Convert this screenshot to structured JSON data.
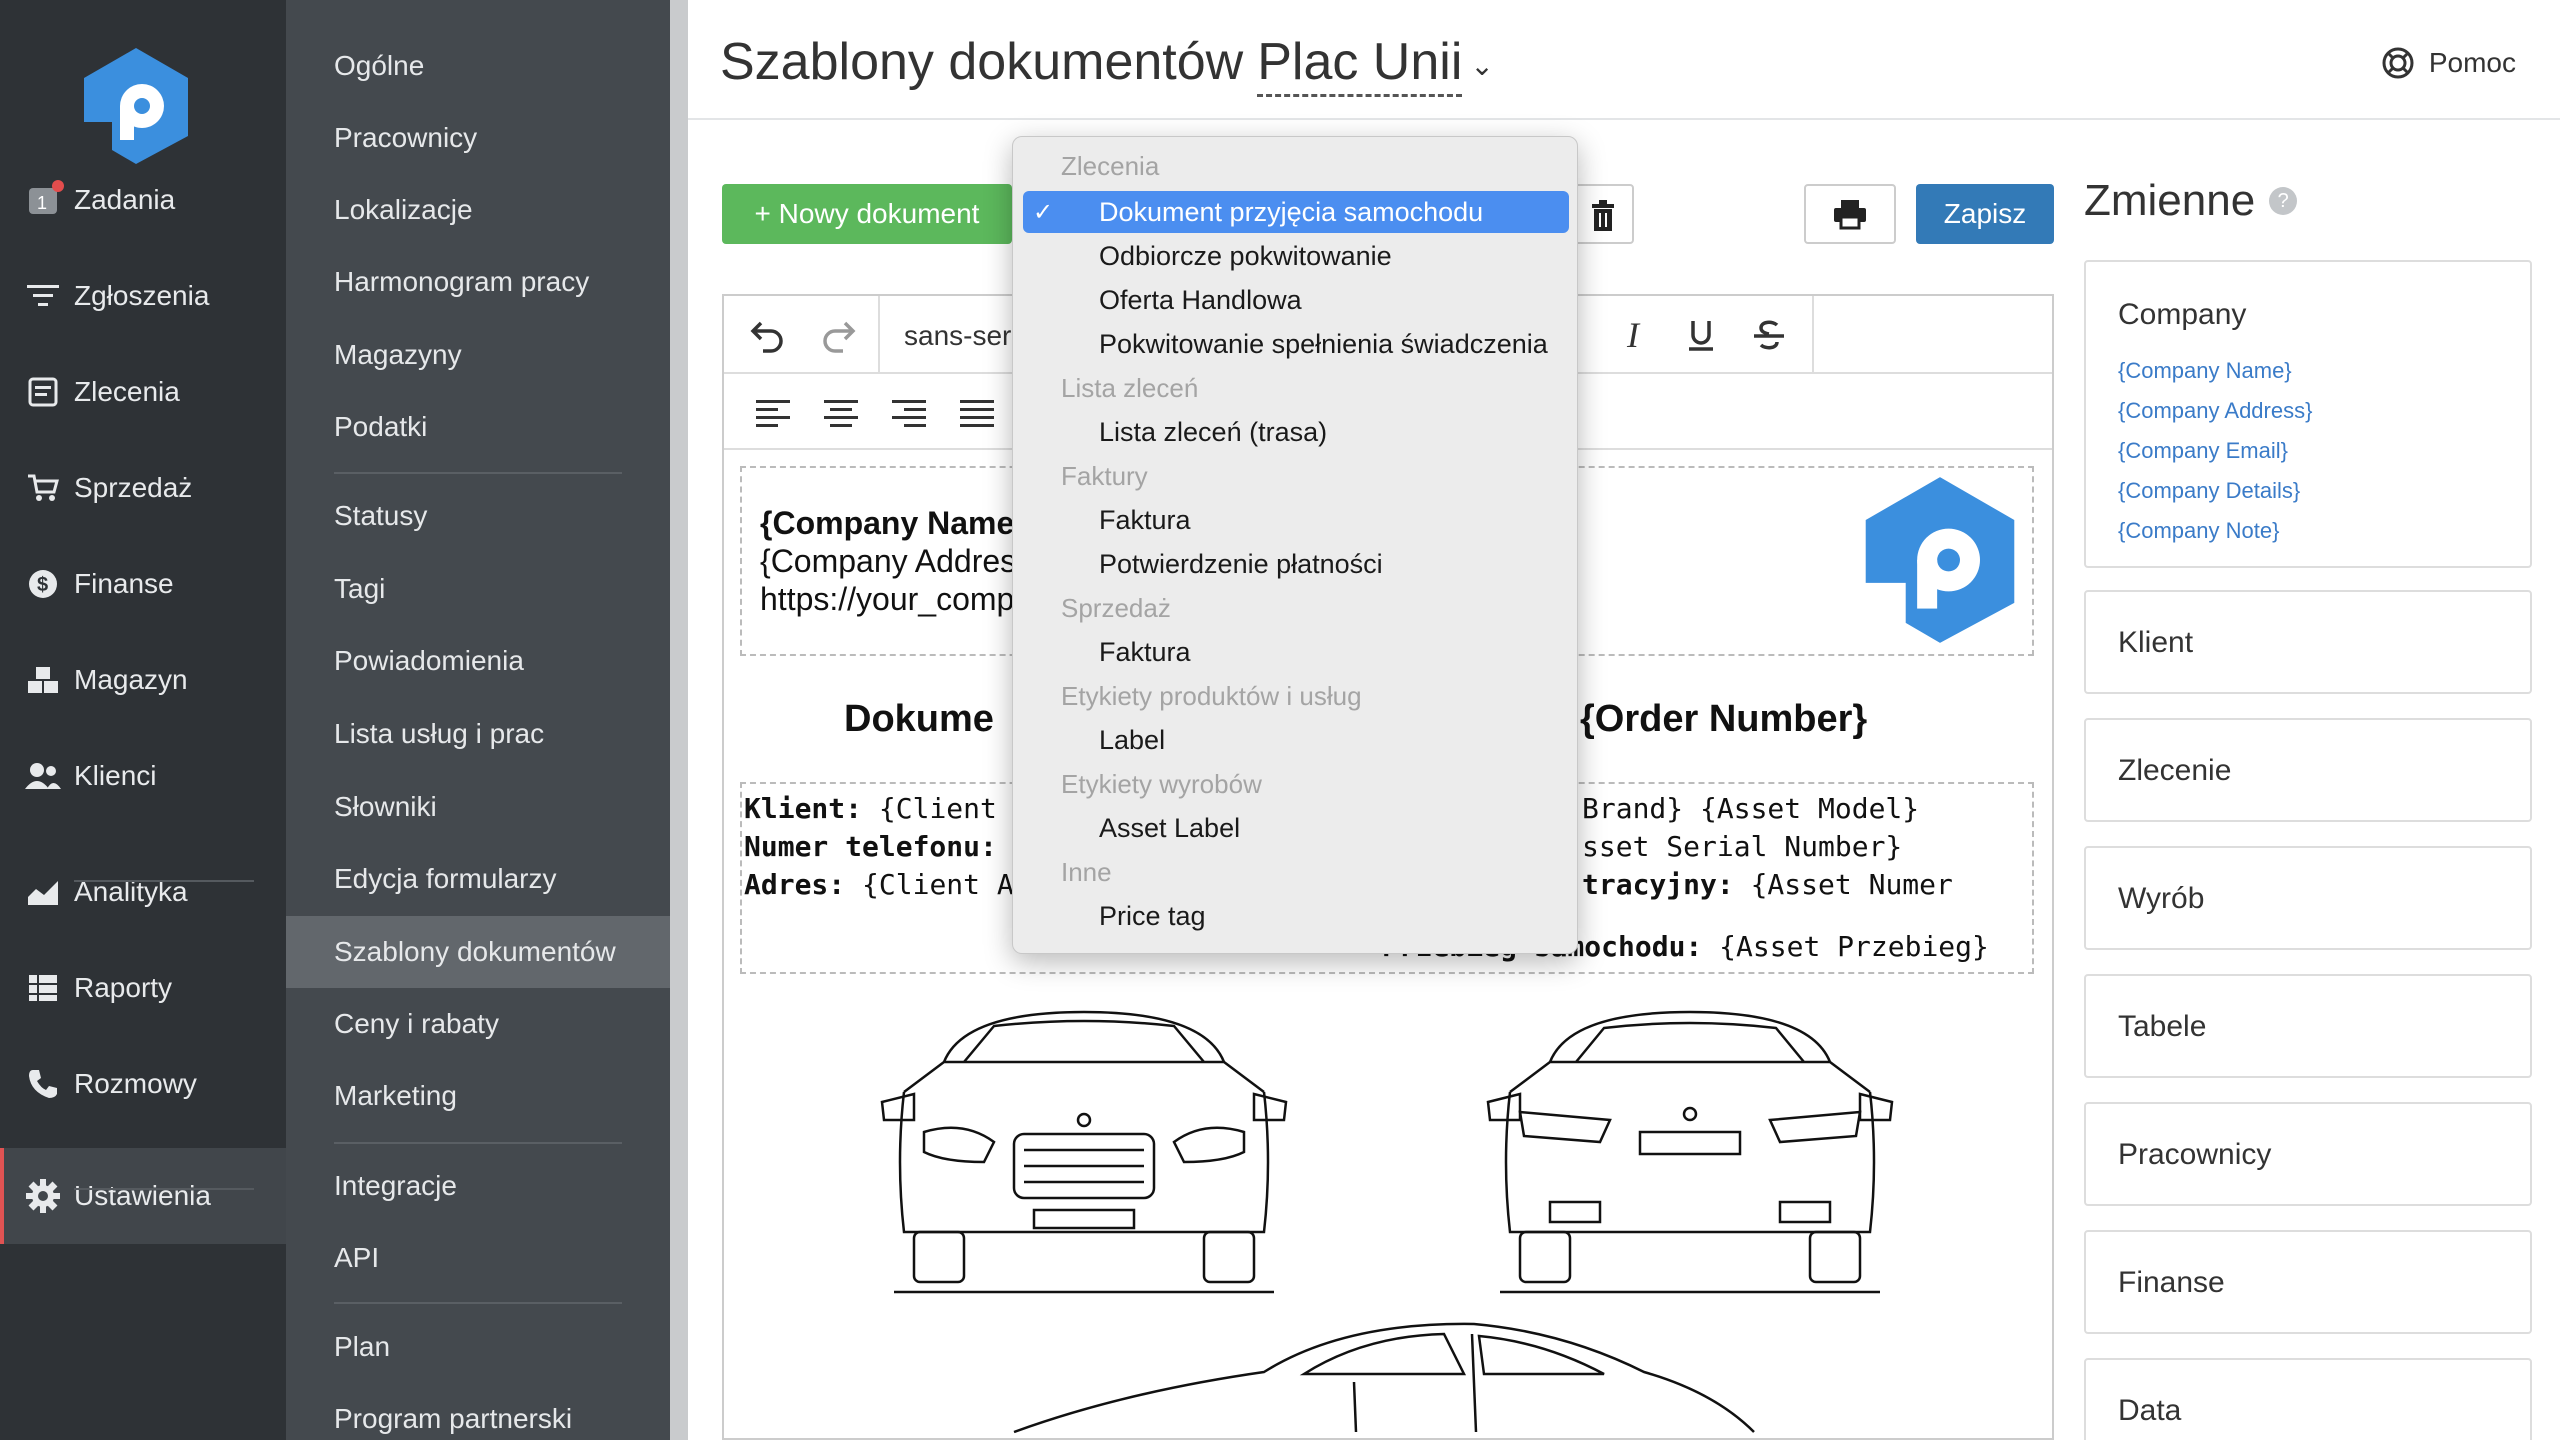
{
  "rail": {
    "items": [
      {
        "label": "Zadania",
        "icon": "tasks-icon"
      },
      {
        "label": "Zgłoszenia",
        "icon": "filter-icon"
      },
      {
        "label": "Zlecenia",
        "icon": "orders-icon"
      },
      {
        "label": "Sprzedaż",
        "icon": "cart-icon"
      },
      {
        "label": "Finanse",
        "icon": "dollar-icon"
      },
      {
        "label": "Magazyn",
        "icon": "warehouse-icon"
      },
      {
        "label": "Klienci",
        "icon": "users-icon"
      },
      {
        "label": "Analityka",
        "icon": "chart-icon"
      },
      {
        "label": "Raporty",
        "icon": "reports-icon"
      },
      {
        "label": "Rozmowy",
        "icon": "phone-icon"
      },
      {
        "label": "Ustawienia",
        "icon": "gear-icon"
      }
    ],
    "tasks_badge": "1",
    "active": "Ustawienia"
  },
  "submenu": {
    "items": [
      "Ogólne",
      "Pracownicy",
      "Lokalizacje",
      "Harmonogram pracy",
      "Magazyny",
      "Podatki",
      "Statusy",
      "Tagi",
      "Powiadomienia",
      "Lista usług i prac",
      "Słowniki",
      "Edycja formularzy",
      "Szablony dokumentów",
      "Ceny i rabaty",
      "Marketing",
      "Integracje",
      "API",
      "Plan",
      "Program partnerski"
    ],
    "active": "Szablony dokumentów"
  },
  "header": {
    "title": "Szablony dokumentów",
    "location": "Plac Unii",
    "help": "Pomoc"
  },
  "toolbar": {
    "new_doc": "+ Nowy dokument",
    "save": "Zapisz",
    "font": "sans-ser"
  },
  "document": {
    "header_lines": [
      "{Company Name}",
      "{Company Address",
      "https://your_compa"
    ],
    "title_left": "Dokume",
    "title_right": "{Order Number}",
    "client_lines": [
      {
        "label": "Klient:",
        "value": "{Client Nam"
      },
      {
        "label": "Numer telefonu:",
        "value": "{"
      },
      {
        "label": "Adres:",
        "value": "{Client Addr"
      }
    ],
    "asset_lines": [
      {
        "label": "",
        "value": "Brand} {Asset Model}"
      },
      {
        "label": "",
        "value": "sset Serial Number}"
      },
      {
        "label": "tracyjny:",
        "value": "{Asset Numer"
      },
      {
        "label": "Przebieg samochodu:",
        "value": "{Asset Przebieg}"
      }
    ]
  },
  "dropdown": {
    "selected": "Dokument przyjęcia samochodu",
    "groups": [
      {
        "name": "Zlecenia",
        "options": [
          "Dokument przyjęcia samochodu",
          "Odbiorcze pokwitowanie",
          "Oferta Handlowa",
          "Pokwitowanie spełnienia świadczenia"
        ]
      },
      {
        "name": "Lista zleceń",
        "options": [
          "Lista zleceń (trasa)"
        ]
      },
      {
        "name": "Faktury",
        "options": [
          "Faktura",
          "Potwierdzenie płatności"
        ]
      },
      {
        "name": "Sprzedaż",
        "options": [
          "Faktura"
        ]
      },
      {
        "name": "Etykiety produktów i usług",
        "options": [
          "Label"
        ]
      },
      {
        "name": "Etykiety wyrobów",
        "options": [
          "Asset Label"
        ]
      },
      {
        "name": "Inne",
        "options": [
          "Price tag"
        ]
      }
    ]
  },
  "variables": {
    "title": "Zmienne",
    "company": {
      "title": "Company",
      "links": [
        "{Company Name}",
        "{Company Address}",
        "{Company Email}",
        "{Company Details}",
        "{Company Note}"
      ]
    },
    "sections": [
      "Klient",
      "Zlecenie",
      "Wyrób",
      "Tabele",
      "Pracownicy",
      "Finanse",
      "Data"
    ]
  },
  "colors": {
    "rail_bg": "#2e3236",
    "submenu_bg": "#44494e",
    "new_button": "#5cb85c",
    "save_button": "#337ab7",
    "selection": "#4b8ef0",
    "link": "#3a7bc8",
    "logo": "#3b8fde"
  }
}
